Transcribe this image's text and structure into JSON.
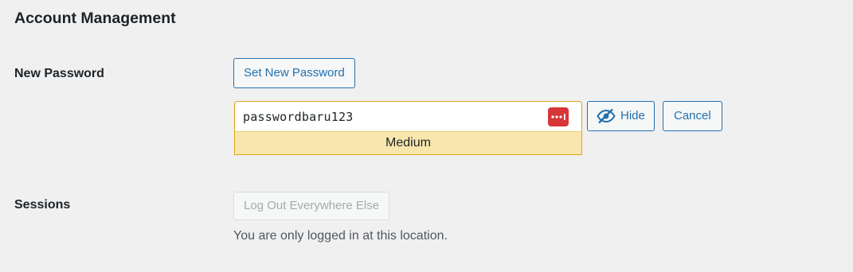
{
  "section": {
    "title": "Account Management"
  },
  "new_password": {
    "label": "New Password",
    "set_button_label": "Set New Password",
    "field_value": "passwordbaru123",
    "password_manager_icon": "password-manager-dots-icon",
    "strength_text": "Medium",
    "hide_button_label": "Hide",
    "hide_icon": "eye-slash-icon",
    "cancel_button_label": "Cancel",
    "strength_color": "#f9e6ad",
    "strength_border_color": "#dba617"
  },
  "sessions": {
    "label": "Sessions",
    "logout_button_label": "Log Out Everywhere Else",
    "note": "You are only logged in at this location."
  },
  "colors": {
    "accent": "#2271b1",
    "background": "#f0f0f1",
    "password_manager_icon": "#d63638"
  }
}
